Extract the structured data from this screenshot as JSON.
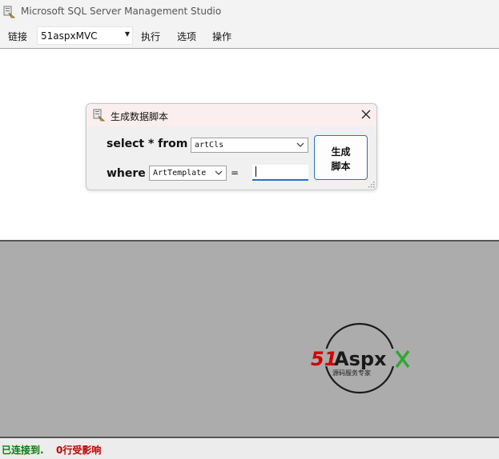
{
  "window": {
    "title": "Microsoft SQL Server Management Studio"
  },
  "menubar": {
    "connect": "链接",
    "database": "51aspxMVC",
    "execute": "执行",
    "options": "选项",
    "operations": "操作"
  },
  "dialog": {
    "title": "生成数据脚本",
    "select_from_label": "select * from",
    "table_value": "artCls",
    "where_label": "where",
    "column_value": "ArtTemplate",
    "equals": "=",
    "input_value": "",
    "generate_button_line1": "生成",
    "generate_button_line2": "脚本"
  },
  "status": {
    "connected": "已连接到.",
    "rows": "0行受影响"
  },
  "logo": {
    "brand_51": "51",
    "brand_aspx": "Aspx",
    "tagline": "源码服务专家"
  },
  "colors": {
    "status_connected": "#0a7a0a",
    "status_rows": "#c00000",
    "focus_blue": "#2a6fcc",
    "logo_red": "#d10000",
    "logo_green": "#2fa82f"
  }
}
